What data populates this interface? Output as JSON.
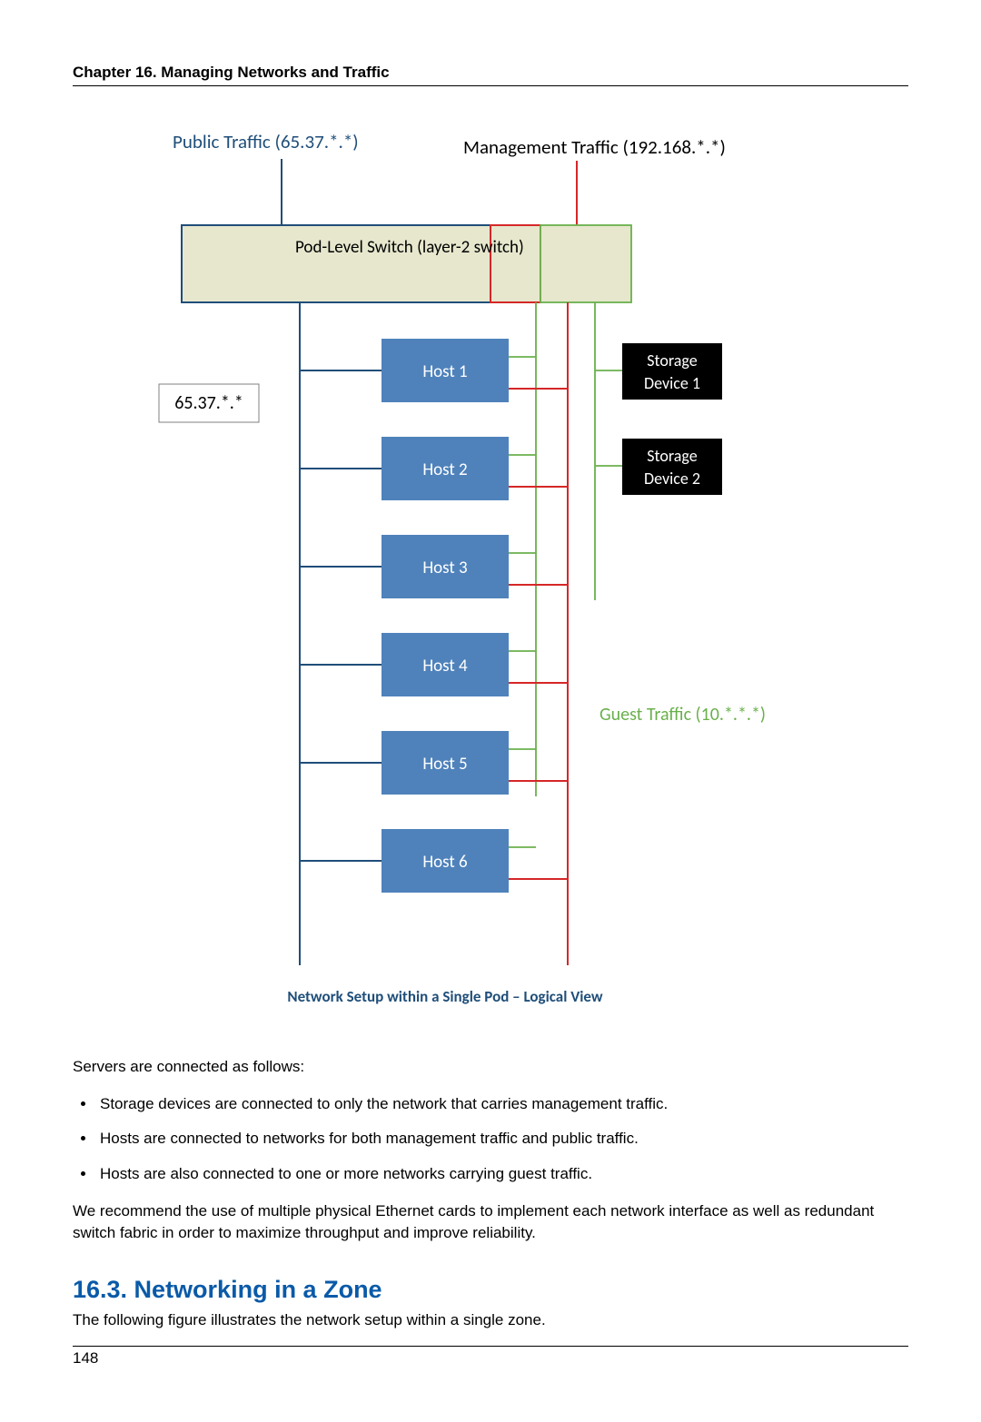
{
  "header": {
    "chapter": "Chapter 16. Managing Networks and Traffic"
  },
  "diagram": {
    "public_label": "Public Traffic (65.37.*.*)",
    "management_label": "Management Traffic (192.168.*.*)",
    "guest_label": "Guest Traffic (10.*.*.*)",
    "switch_label": "Pod-Level Switch (layer-2 switch)",
    "public_box": "65.37.*.*",
    "hosts": [
      "Host 1",
      "Host 2",
      "Host 3",
      "Host 4",
      "Host 5",
      "Host 6"
    ],
    "storage": [
      "Storage\nDevice 1",
      "Storage\nDevice 2"
    ],
    "caption": "Network Setup within a Single Pod – Logical View"
  },
  "body": {
    "intro": "Servers are connected as follows:",
    "bullets": [
      "Storage devices are connected to only the network that carries management traffic.",
      "Hosts are connected to networks for both management traffic and public traffic.",
      "Hosts are also connected to one or more networks carrying guest traffic."
    ],
    "rec": "We recommend the use of multiple physical Ethernet cards to implement each network interface as well as redundant switch fabric in order to maximize throughput and improve reliability."
  },
  "section": {
    "heading": "16.3. Networking in a Zone",
    "lead": "The following figure illustrates the network setup within a single zone."
  },
  "footer": {
    "page": "148"
  },
  "colors": {
    "switch_fill": "#e6e7cd",
    "host_fill": "#4f82bb",
    "storage_fill": "#000000",
    "public_stroke": "#000000",
    "mgmt_stroke": "#d62728",
    "guest_stroke": "#6ab04c",
    "caption_blue": "#1f4e79"
  }
}
